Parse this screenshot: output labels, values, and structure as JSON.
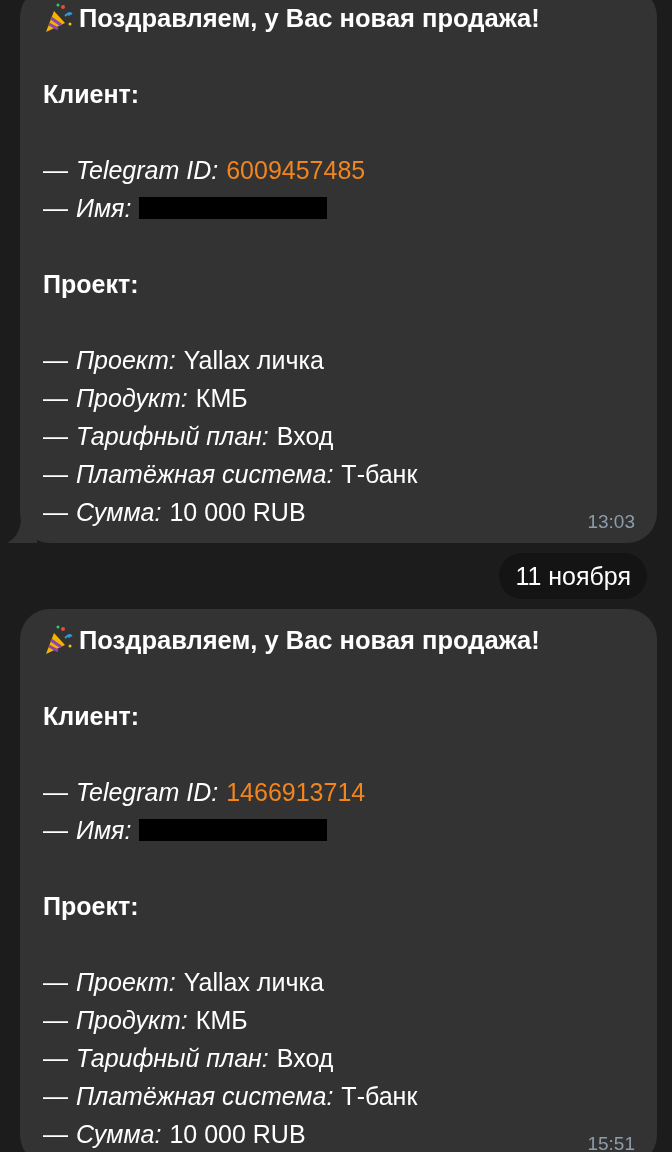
{
  "chat": [
    {
      "kind": "message",
      "tail": true,
      "title": "Поздравляем, у Вас новая продажа!",
      "sections": [
        {
          "heading": "Клиент:",
          "fields": [
            {
              "kind": "link",
              "prefix": "—",
              "label": "Telegram ID:",
              "value": "6009457485"
            },
            {
              "kind": "redacted",
              "prefix": "—",
              "label": "Имя:"
            }
          ]
        },
        {
          "heading": "Проект:",
          "fields": [
            {
              "kind": "plain",
              "prefix": "—",
              "label": "Проект:",
              "value": "Yallax личка"
            },
            {
              "kind": "plain",
              "prefix": "—",
              "label": "Продукт:",
              "value": "КМБ"
            },
            {
              "kind": "plain",
              "prefix": "—",
              "label": "Тарифный план:",
              "value": "Вход"
            },
            {
              "kind": "plain",
              "prefix": "—",
              "label": "Платёжная система:",
              "value": "Т-банк"
            },
            {
              "kind": "plain",
              "prefix": "—",
              "label": "Сумма:",
              "value": "10 000 RUB"
            }
          ]
        }
      ],
      "time": "13:03"
    },
    {
      "kind": "date",
      "text": "11 ноября"
    },
    {
      "kind": "message",
      "tail": false,
      "title": "Поздравляем, у Вас новая продажа!",
      "sections": [
        {
          "heading": "Клиент:",
          "fields": [
            {
              "kind": "link",
              "prefix": "—",
              "label": "Telegram ID:",
              "value": "1466913714"
            },
            {
              "kind": "redacted",
              "prefix": "—",
              "label": "Имя:"
            }
          ]
        },
        {
          "heading": "Проект:",
          "fields": [
            {
              "kind": "plain",
              "prefix": "—",
              "label": "Проект:",
              "value": "Yallax личка"
            },
            {
              "kind": "plain",
              "prefix": "—",
              "label": "Продукт:",
              "value": "КМБ"
            },
            {
              "kind": "plain",
              "prefix": "—",
              "label": "Тарифный план:",
              "value": "Вход"
            },
            {
              "kind": "plain",
              "prefix": "—",
              "label": "Платёжная система:",
              "value": "Т-банк"
            },
            {
              "kind": "plain",
              "prefix": "—",
              "label": "Сумма:",
              "value": "10 000 RUB"
            }
          ]
        }
      ],
      "time": "15:51"
    }
  ]
}
